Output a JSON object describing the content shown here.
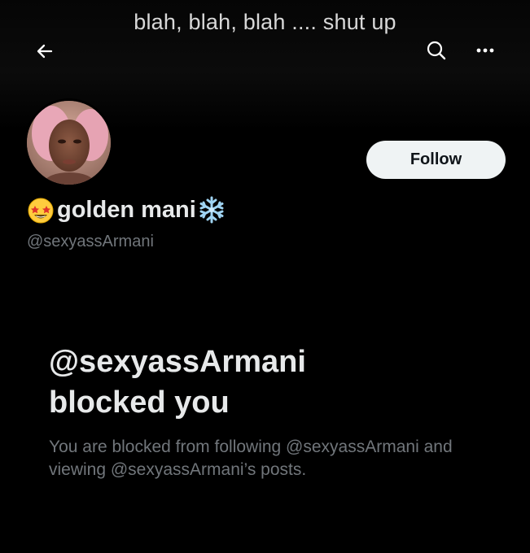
{
  "caption": "blah, blah, blah .... shut up",
  "icons": {
    "back": "back-arrow-icon",
    "search": "search-icon",
    "more": "more-dots-icon",
    "name_prefix_emoji": "star-struck-emoji",
    "name_suffix_emoji": "snowflake-emoji"
  },
  "profile": {
    "display_name": "golden mani",
    "handle": "@sexyassArmani"
  },
  "follow_button": {
    "label": "Follow"
  },
  "blocked": {
    "title_line1": "@sexyassArmani",
    "title_line2": "blocked you",
    "message": "You are blocked from following @sexyassArmani and viewing @sexyassArmani’s posts."
  },
  "colors": {
    "background": "#000000",
    "primary_text": "#e7e9ea",
    "secondary_text": "#71767b",
    "follow_bg": "#eff3f4"
  }
}
